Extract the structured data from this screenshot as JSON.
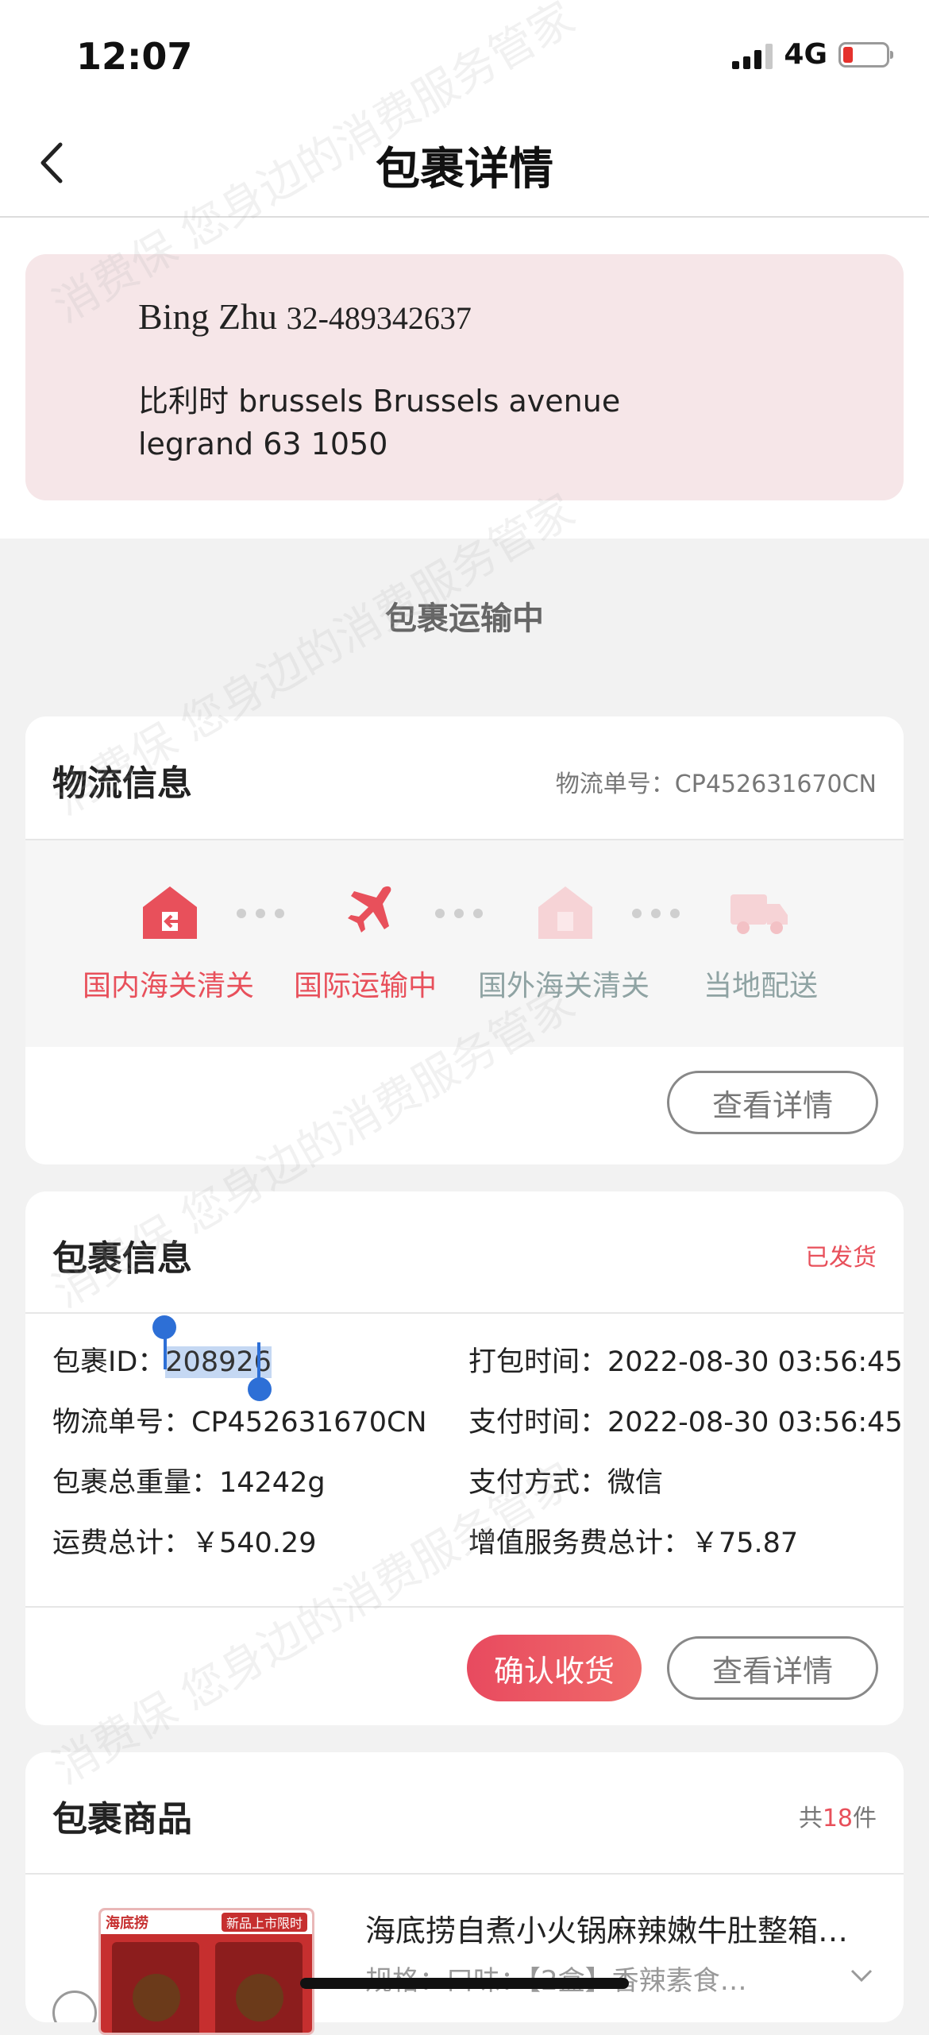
{
  "status_bar": {
    "time": "12:07",
    "network": "4G"
  },
  "nav": {
    "title": "包裹详情"
  },
  "address": {
    "name": "Bing Zhu",
    "phone": "32-489342637",
    "line1": "比利时 brussels Brussels avenue",
    "line2": "legrand 63 1050"
  },
  "transit_status": "包裹运输中",
  "logistics": {
    "title": "物流信息",
    "tracking_label": "物流单号：CP452631670CN",
    "steps": [
      {
        "label": "国内海关清关",
        "icon": "customs-icon",
        "active": true
      },
      {
        "label": "国际运输中",
        "icon": "airplane-icon",
        "active": true
      },
      {
        "label": "国外海关清关",
        "icon": "customs-icon",
        "active": false
      },
      {
        "label": "当地配送",
        "icon": "truck-icon",
        "active": false
      }
    ],
    "detail_button": "查看详情"
  },
  "package": {
    "title": "包裹信息",
    "status": "已发货",
    "id_label": "包裹ID：",
    "id_value": "208926",
    "tracking": "物流单号：CP452631670CN",
    "weight": "包裹总重量：14242g",
    "shipping_fee": "运费总计：￥540.29",
    "pack_time": "打包时间：2022-08-30 03:56:45",
    "pay_time": "支付时间：2022-08-30 03:56:45",
    "pay_method": "支付方式：微信",
    "service_fee": "增值服务费总计：￥75.87",
    "confirm_button": "确认收货",
    "detail_button": "查看详情"
  },
  "goods": {
    "title": "包裹商品",
    "count_prefix": "共",
    "count": "18",
    "count_suffix": "件",
    "item": {
      "title": "海底捞自煮小火锅麻辣嫩牛肚整箱…",
      "spec": "规格：口味：【2盒】香辣素食…",
      "brand": "海底捞",
      "banner": "新品上市限时"
    }
  },
  "watermark": "消费保 您身边的消费服务管家",
  "colors": {
    "accent": "#e84a5f",
    "inactive": "#8fa3a3"
  }
}
